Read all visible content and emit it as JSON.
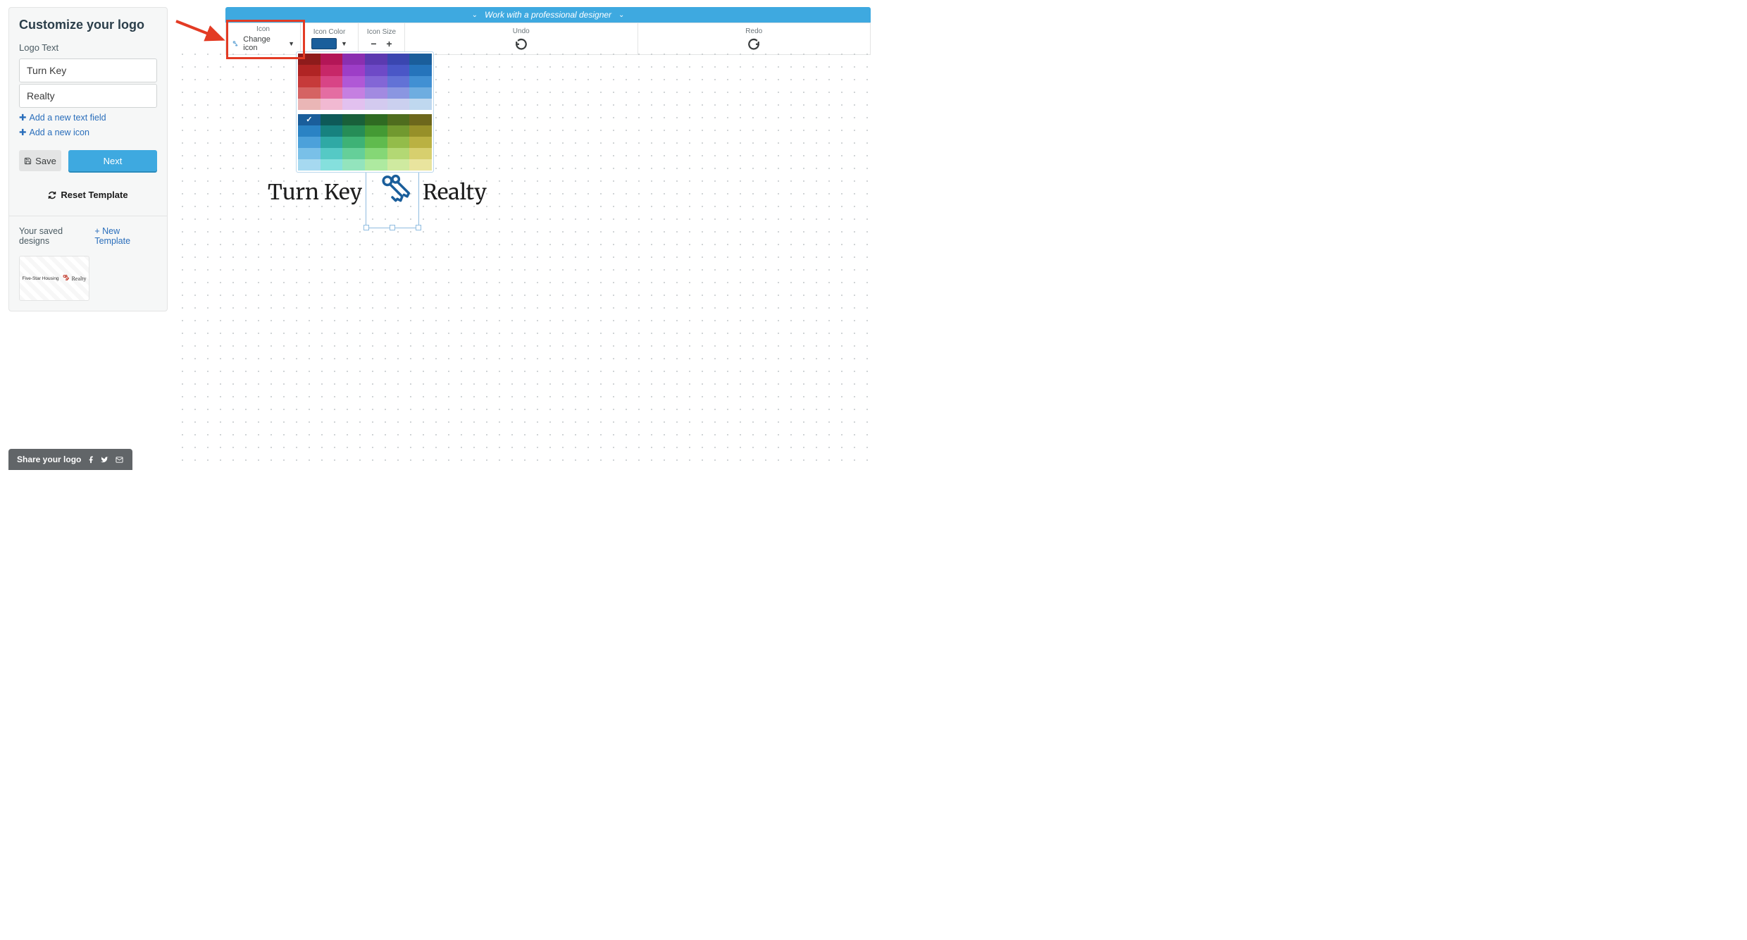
{
  "sidebar": {
    "title": "Customize your logo",
    "logo_text_label": "Logo Text",
    "text_line1": "Turn Key",
    "text_line2": "Realty",
    "add_text_field": "Add a new text field",
    "add_icon": "Add a new icon",
    "save_label": "Save",
    "next_label": "Next",
    "reset_label": "Reset Template"
  },
  "saved": {
    "label": "Your saved designs",
    "new_template": "+ New Template",
    "card1_text_left": "Five-Star Housing",
    "card1_text_right": "Realty"
  },
  "share": {
    "label": "Share your logo"
  },
  "designer_bar": {
    "text": "Work with a professional designer"
  },
  "toolbar": {
    "icon_label": "Icon",
    "change_icon": "Change icon",
    "color_label": "Icon Color",
    "size_label": "Icon Size",
    "undo_label": "Undo",
    "redo_label": "Redo",
    "selected_color": "#1a5e9b"
  },
  "palette": {
    "group1": [
      "#8e1b1b",
      "#b31657",
      "#8a2fb0",
      "#5b3ab0",
      "#3a46b0",
      "#1a5e9b",
      "#b02424",
      "#c72768",
      "#9d3ec7",
      "#6e4ac7",
      "#4a57c7",
      "#2574bb",
      "#c63a3a",
      "#d84486",
      "#b058d6",
      "#8366d6",
      "#6272d6",
      "#4190d3",
      "#d56363",
      "#e46da2",
      "#c57fe1",
      "#a28ae1",
      "#8a96e1",
      "#6eade0",
      "#eab6b6",
      "#f1b9d2",
      "#e2c1ef",
      "#d3caef",
      "#cbd0ef",
      "#bfd8ef"
    ],
    "group2": [
      "#1a5e9b",
      "#0e5a58",
      "#19603a",
      "#2f6b22",
      "#4f6d1e",
      "#6d671c",
      "#2a83c4",
      "#17827f",
      "#268d57",
      "#449a34",
      "#71992f",
      "#979029",
      "#4ca1da",
      "#2fa9a5",
      "#3eb276",
      "#60bb4e",
      "#93bc4a",
      "#bab142",
      "#79c0e8",
      "#55c9c5",
      "#65cf99",
      "#85d776",
      "#b3d874",
      "#d7cf6e",
      "#a6d9f0",
      "#85e0dd",
      "#93e4bd",
      "#aeeaa0",
      "#cfeaa0",
      "#e9e49e"
    ],
    "selected": "#1a5e9b"
  },
  "logo": {
    "left_text": "Turn Key",
    "right_text": "Realty",
    "icon_color": "#1a5e9b"
  }
}
